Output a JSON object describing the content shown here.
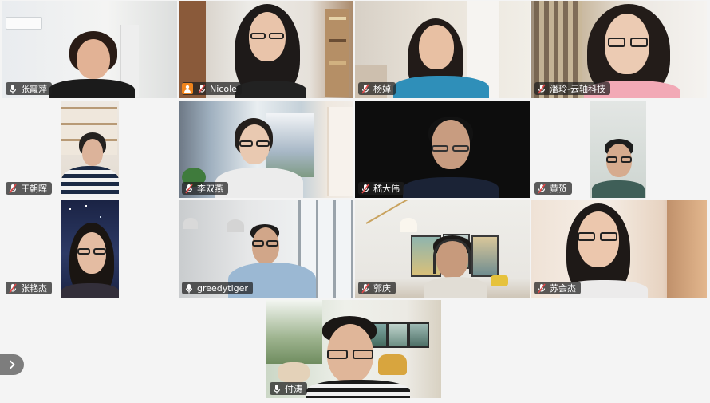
{
  "gallery": {
    "participants": [
      {
        "name": "张霞萍",
        "mic": "on",
        "host": false,
        "active": true
      },
      {
        "name": "Nicole",
        "mic": "muted",
        "host": true,
        "active": false
      },
      {
        "name": "杨婥",
        "mic": "muted",
        "host": false,
        "active": false
      },
      {
        "name": "潘玲-云轴科技",
        "mic": "muted",
        "host": false,
        "active": false
      },
      {
        "name": "王朝晖",
        "mic": "muted",
        "host": false,
        "active": false
      },
      {
        "name": "李双燕",
        "mic": "muted",
        "host": false,
        "active": false
      },
      {
        "name": "嵇大伟",
        "mic": "muted",
        "host": false,
        "active": false
      },
      {
        "name": "黄贺",
        "mic": "muted",
        "host": false,
        "active": false
      },
      {
        "name": "张艳杰",
        "mic": "muted",
        "host": false,
        "active": false
      },
      {
        "name": "greedytiger",
        "mic": "on",
        "host": false,
        "active": false
      },
      {
        "name": "郭庆",
        "mic": "muted",
        "host": false,
        "active": false
      },
      {
        "name": "苏会杰",
        "mic": "muted",
        "host": false,
        "active": false
      },
      {
        "name": "付涛",
        "mic": "on",
        "host": false,
        "active": false
      }
    ]
  },
  "colors": {
    "active_speaker_border": "#39d18a",
    "host_badge": "#f0841c",
    "muted_icon": "#e04848",
    "tile_background": "#f4f4f4",
    "label_background": "#1e1e1e"
  },
  "icons": {
    "mic_on": "microphone-icon",
    "mic_muted": "microphone-muted-icon",
    "host": "host-user-icon",
    "scroll": "chevron-right-icon"
  }
}
